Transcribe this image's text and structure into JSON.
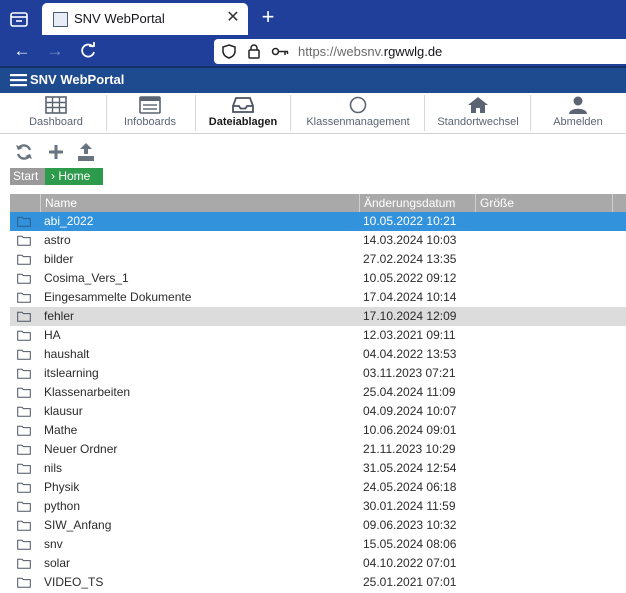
{
  "browser": {
    "tab_title": "SNV WebPortal",
    "url_prefix": "https://websnv.",
    "url_domain": "rgwwlg.de"
  },
  "app": {
    "title": "SNV WebPortal"
  },
  "toolbar": {
    "items": [
      {
        "label": "Dashboard",
        "icon": "grid-icon"
      },
      {
        "label": "Infoboards",
        "icon": "board-icon"
      },
      {
        "label": "Dateiablagen",
        "icon": "inbox-icon",
        "active": true
      },
      {
        "label": "Klassenmanagement",
        "icon": "circle-icon"
      },
      {
        "label": "Standortwechsel",
        "icon": "home-icon"
      },
      {
        "label": "Abmelden",
        "icon": "user-icon"
      }
    ]
  },
  "actions": [
    "refresh-icon",
    "add-icon",
    "upload-icon"
  ],
  "breadcrumb": {
    "start": "Start",
    "home": "› Home"
  },
  "table": {
    "headers": {
      "name": "Name",
      "date": "Änderungsdatum",
      "size": "Größe"
    },
    "rows": [
      {
        "name": "abi_2022",
        "date": "10.05.2022 10:21",
        "state": "selected"
      },
      {
        "name": "astro",
        "date": "14.03.2024 10:03"
      },
      {
        "name": "bilder",
        "date": "27.02.2024 13:35"
      },
      {
        "name": "Cosima_Vers_1",
        "date": "10.05.2022 09:12"
      },
      {
        "name": "Eingesammelte Dokumente",
        "date": "17.04.2024 10:14"
      },
      {
        "name": "fehler",
        "date": "17.10.2024 12:09",
        "state": "hover"
      },
      {
        "name": "HA",
        "date": "12.03.2021 09:11"
      },
      {
        "name": "haushalt",
        "date": "04.04.2022 13:53"
      },
      {
        "name": "itslearning",
        "date": "03.11.2023 07:21"
      },
      {
        "name": "Klassenarbeiten",
        "date": "25.04.2024 11:09"
      },
      {
        "name": "klausur",
        "date": "04.09.2024 10:07"
      },
      {
        "name": "Mathe",
        "date": "10.06.2024 09:01"
      },
      {
        "name": "Neuer Ordner",
        "date": "21.11.2023 10:29"
      },
      {
        "name": "nils",
        "date": "31.05.2024 12:54"
      },
      {
        "name": "Physik",
        "date": "24.05.2024 06:18"
      },
      {
        "name": "python",
        "date": "30.01.2024 11:59"
      },
      {
        "name": "SIW_Anfang",
        "date": "09.06.2023 10:32"
      },
      {
        "name": "snv",
        "date": "15.05.2024 08:06"
      },
      {
        "name": "solar",
        "date": "04.10.2022 07:01"
      },
      {
        "name": "VIDEO_TS",
        "date": "25.01.2021 07:01"
      }
    ]
  },
  "colors": {
    "browser_chrome": "#1f3f9a",
    "app_header": "#1e4a8f",
    "selected_row": "#3392dc",
    "breadcrumb_home": "#2e9a4c"
  }
}
